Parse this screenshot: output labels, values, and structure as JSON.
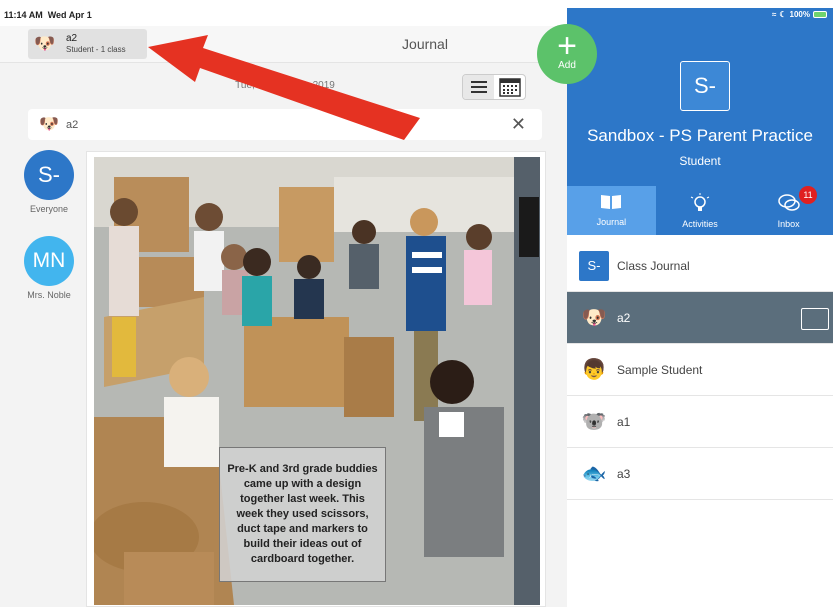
{
  "status_bar": {
    "time": "11:14 AM",
    "date": "Wed Apr 1",
    "battery": "100%"
  },
  "header": {
    "student_name": "a2",
    "student_sub": "Student - 1 class",
    "title": "Journal"
  },
  "journal": {
    "date": "Tue, October 22, 2019",
    "filter_name": "a2",
    "close": "✕"
  },
  "audience": [
    {
      "initials": "S-",
      "label": "Everyone"
    },
    {
      "initials": "MN",
      "label": "Mrs. Noble"
    }
  ],
  "post": {
    "caption": "Pre-K and 3rd grade buddies came up with a design together last week. This week they used scissors, duct tape and markers to build their ideas out of cardboard together."
  },
  "fab": {
    "label": "Add",
    "symbol": "+"
  },
  "class": {
    "initials": "S-",
    "name": "Sandbox - PS Parent Practice",
    "role": "Student"
  },
  "tabs": [
    {
      "label": "Journal",
      "icon": "book-icon"
    },
    {
      "label": "Activities",
      "icon": "lightbulb-icon"
    },
    {
      "label": "Inbox",
      "icon": "chat-icon",
      "badge": "11"
    }
  ],
  "list": [
    {
      "label": "Class Journal",
      "icon": "S-"
    },
    {
      "label": "a2",
      "icon": "🐶"
    },
    {
      "label": "Sample Student",
      "icon": "👦"
    },
    {
      "label": "a1",
      "icon": "🐨"
    },
    {
      "label": "a3",
      "icon": "🐟"
    }
  ],
  "colors": {
    "primary": "#2d77c8",
    "add": "#5cc26a",
    "badge": "#e02020",
    "selected_row": "#5b6e7c"
  }
}
